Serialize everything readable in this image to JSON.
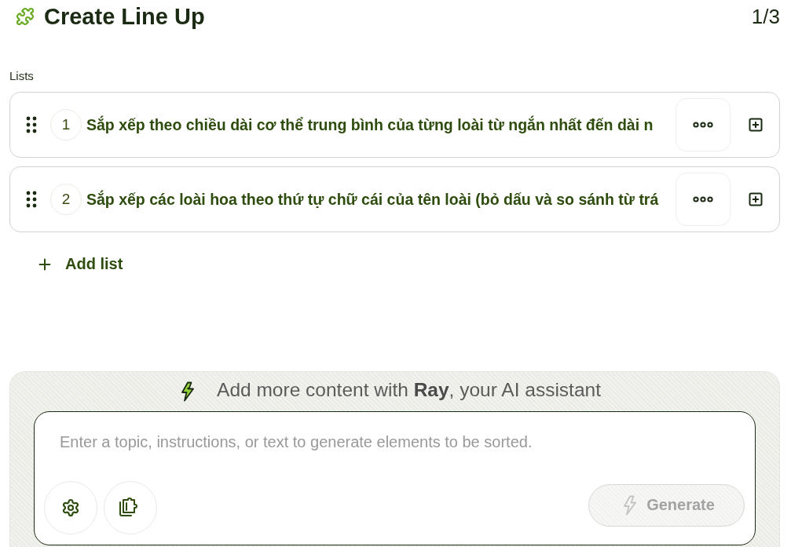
{
  "header": {
    "title": "Create Line Up",
    "step": "1/3"
  },
  "lists_label": "Lists",
  "lists": [
    {
      "number": "1",
      "text": "Sắp xếp theo chiều dài cơ thể trung bình của từng loài từ ngắn nhất đến dài n"
    },
    {
      "number": "2",
      "text": "Sắp xếp các loài hoa theo thứ tự chữ cái của tên loài (bỏ dấu và so sánh từ trá"
    }
  ],
  "add_list": {
    "label": "Add list"
  },
  "assistant": {
    "heading": "Add more content with **Ray**, your AI assistant",
    "input": {
      "placeholder": "Enter a topic, instructions, or text to generate elements to be sorted."
    },
    "generate": {
      "label": "Generate",
      "disabled": true
    }
  }
}
